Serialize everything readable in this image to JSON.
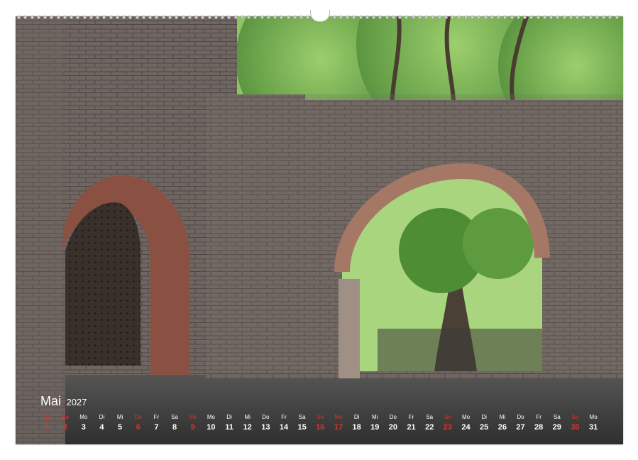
{
  "calendar": {
    "month": "Mai",
    "year": "2027",
    "days": [
      {
        "weekday": "Sa",
        "day": "1",
        "weekend": true
      },
      {
        "weekday": "So",
        "day": "2",
        "weekend": true
      },
      {
        "weekday": "Mo",
        "day": "3",
        "weekend": false
      },
      {
        "weekday": "Di",
        "day": "4",
        "weekend": false
      },
      {
        "weekday": "Mi",
        "day": "5",
        "weekend": false
      },
      {
        "weekday": "Do",
        "day": "6",
        "weekend": true
      },
      {
        "weekday": "Fr",
        "day": "7",
        "weekend": false
      },
      {
        "weekday": "Sa",
        "day": "8",
        "weekend": false
      },
      {
        "weekday": "So",
        "day": "9",
        "weekend": true
      },
      {
        "weekday": "Mo",
        "day": "10",
        "weekend": false
      },
      {
        "weekday": "Di",
        "day": "11",
        "weekend": false
      },
      {
        "weekday": "Mi",
        "day": "12",
        "weekend": false
      },
      {
        "weekday": "Do",
        "day": "13",
        "weekend": false
      },
      {
        "weekday": "Fr",
        "day": "14",
        "weekend": false
      },
      {
        "weekday": "Sa",
        "day": "15",
        "weekend": false
      },
      {
        "weekday": "So",
        "day": "16",
        "weekend": true
      },
      {
        "weekday": "Mo",
        "day": "17",
        "weekend": true
      },
      {
        "weekday": "Di",
        "day": "18",
        "weekend": false
      },
      {
        "weekday": "Mi",
        "day": "19",
        "weekend": false
      },
      {
        "weekday": "Do",
        "day": "20",
        "weekend": false
      },
      {
        "weekday": "Fr",
        "day": "21",
        "weekend": false
      },
      {
        "weekday": "Sa",
        "day": "22",
        "weekend": false
      },
      {
        "weekday": "So",
        "day": "23",
        "weekend": true
      },
      {
        "weekday": "Mo",
        "day": "24",
        "weekend": false
      },
      {
        "weekday": "Di",
        "day": "25",
        "weekend": false
      },
      {
        "weekday": "Mi",
        "day": "26",
        "weekend": false
      },
      {
        "weekday": "Do",
        "day": "27",
        "weekend": false
      },
      {
        "weekday": "Fr",
        "day": "28",
        "weekend": false
      },
      {
        "weekday": "Sa",
        "day": "29",
        "weekend": false
      },
      {
        "weekday": "So",
        "day": "30",
        "weekend": true
      },
      {
        "weekday": "Mo",
        "day": "31",
        "weekend": false
      }
    ]
  },
  "colors": {
    "weekend": "#d9332c",
    "weekday": "#ffffff"
  }
}
